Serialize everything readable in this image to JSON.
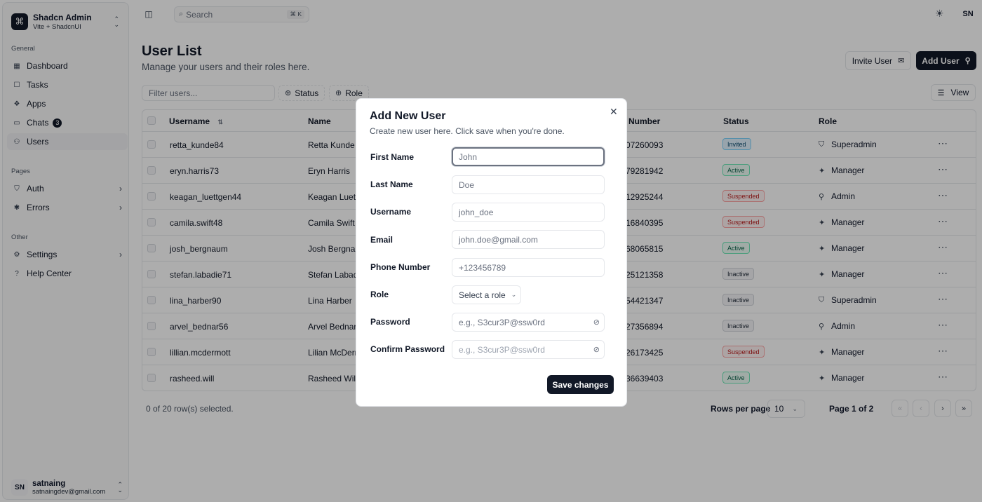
{
  "brand": {
    "name": "Shadcn Admin",
    "sub": "Vite + ShadcnUI"
  },
  "sidebar": {
    "general_label": "General",
    "general": [
      {
        "label": "Dashboard"
      },
      {
        "label": "Tasks"
      },
      {
        "label": "Apps"
      },
      {
        "label": "Chats",
        "badge": "3"
      },
      {
        "label": "Users"
      }
    ],
    "pages_label": "Pages",
    "pages": [
      {
        "label": "Auth"
      },
      {
        "label": "Errors"
      }
    ],
    "other_label": "Other",
    "other": [
      {
        "label": "Settings"
      },
      {
        "label": "Help Center"
      }
    ]
  },
  "user": {
    "initials": "SN",
    "name": "satnaing",
    "email": "satnaingdev@gmail.com"
  },
  "topbar": {
    "search_placeholder": "Search",
    "shortcut": "⌘ K",
    "avatar": "SN"
  },
  "page": {
    "title": "User List",
    "subtitle": "Manage your users and their roles here.",
    "invite_label": "Invite User",
    "add_label": "Add User"
  },
  "toolbar": {
    "filter_placeholder": "Filter users...",
    "status_label": "Status",
    "role_label": "Role",
    "view_label": "View"
  },
  "table": {
    "headers": {
      "username": "Username",
      "name": "Name",
      "phone": "e Number",
      "status": "Status",
      "role": "Role"
    },
    "rows": [
      {
        "username": "retta_kunde84",
        "name": "Retta Kunde",
        "phone": "07260093",
        "status": "Invited",
        "role": "Superadmin"
      },
      {
        "username": "eryn.harris73",
        "name": "Eryn Harris",
        "phone": "79281942",
        "status": "Active",
        "role": "Manager"
      },
      {
        "username": "keagan_luettgen44",
        "name": "Keagan Luettg",
        "phone": "12925244",
        "status": "Suspended",
        "role": "Admin"
      },
      {
        "username": "camila.swift48",
        "name": "Camila Swift",
        "phone": "16840395",
        "status": "Suspended",
        "role": "Manager"
      },
      {
        "username": "josh_bergnaum",
        "name": "Josh Bergnau",
        "phone": "68065815",
        "status": "Active",
        "role": "Manager"
      },
      {
        "username": "stefan.labadie71",
        "name": "Stefan Labadi",
        "phone": "25121358",
        "status": "Inactive",
        "role": "Manager"
      },
      {
        "username": "lina_harber90",
        "name": "Lina Harber",
        "phone": "54421347",
        "status": "Inactive",
        "role": "Superadmin"
      },
      {
        "username": "arvel_bednar56",
        "name": "Arvel Bednar",
        "phone": "27356894",
        "status": "Inactive",
        "role": "Admin"
      },
      {
        "username": "lillian.mcdermott",
        "name": "Lilian McDerm",
        "phone": "26173425",
        "status": "Suspended",
        "role": "Manager"
      },
      {
        "username": "rasheed.will",
        "name": "Rasheed Will",
        "phone": "36639403",
        "status": "Active",
        "role": "Manager"
      }
    ]
  },
  "footer": {
    "selected": "0 of 20 row(s) selected.",
    "rows_per_page_label": "Rows per page",
    "rows_per_page": "10",
    "page_of": "Page 1 of 2"
  },
  "modal": {
    "title": "Add New User",
    "subtitle": "Create new user here. Click save when you're done.",
    "fields": [
      {
        "label": "First Name",
        "placeholder": "John"
      },
      {
        "label": "Last Name",
        "placeholder": "Doe"
      },
      {
        "label": "Username",
        "placeholder": "john_doe"
      },
      {
        "label": "Email",
        "placeholder": "john.doe@gmail.com"
      },
      {
        "label": "Phone Number",
        "placeholder": "+123456789"
      }
    ],
    "role_label": "Role",
    "role_placeholder": "Select a role",
    "password_label": "Password",
    "password_placeholder": "e.g., S3cur3P@ssw0rd",
    "confirm_label": "Confirm Password",
    "confirm_placeholder": "e.g., S3cur3P@ssw0rd",
    "save_label": "Save changes"
  },
  "status_colors": {
    "Invited": {
      "bg": "#e0f2fe",
      "border": "#7dd3fc",
      "text": "#0c4a6e"
    },
    "Active": {
      "bg": "#ecfdf5",
      "border": "#6ee7b7",
      "text": "#065f46"
    },
    "Suspended": {
      "bg": "#fef2f2",
      "border": "#fca5a5",
      "text": "#b91c1c"
    },
    "Inactive": {
      "bg": "#f3f4f6",
      "border": "#d1d5db",
      "text": "#1f2937"
    }
  },
  "role_icons": {
    "Superadmin": "shield-icon",
    "Manager": "briefcase-icon",
    "Admin": "user-icon"
  }
}
